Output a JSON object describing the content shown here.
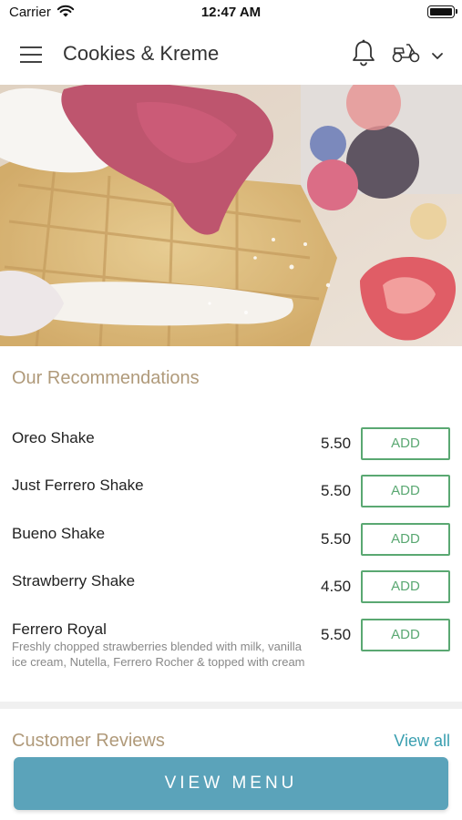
{
  "status_bar": {
    "carrier": "Carrier",
    "time": "12:47 AM",
    "icons": [
      "wifi-icon",
      "battery-icon"
    ]
  },
  "header": {
    "title": "Cookies & Kreme",
    "icons": [
      "hamburger-menu-icon",
      "bell-icon",
      "scooter-icon",
      "chevron-down-icon"
    ]
  },
  "hero": {
    "description_icon": "waffle-berries-photo"
  },
  "recommendations": {
    "title": "Our Recommendations",
    "items": [
      {
        "name": "Oreo Shake",
        "description": "",
        "price": "5.50",
        "button": "ADD"
      },
      {
        "name": "Just Ferrero Shake",
        "description": "",
        "price": "5.50",
        "button": "ADD"
      },
      {
        "name": "Bueno Shake",
        "description": "",
        "price": "5.50",
        "button": "ADD"
      },
      {
        "name": "Strawberry Shake",
        "description": "",
        "price": "4.50",
        "button": "ADD"
      },
      {
        "name": "Ferrero Royal",
        "description": "Freshly chopped strawberries blended with milk, vanilla ice cream, Nutella, Ferrero Rocher & topped with cream",
        "price": "5.50",
        "button": "ADD"
      }
    ]
  },
  "reviews": {
    "title": "Customer Reviews",
    "view_all": "View all"
  },
  "footer": {
    "button": "VIEW MENU"
  },
  "colors": {
    "accent_gold": "#b09a7a",
    "add_green": "#5aa872",
    "link_blue": "#3a9fb0",
    "primary_button": "#5ba3ba"
  }
}
